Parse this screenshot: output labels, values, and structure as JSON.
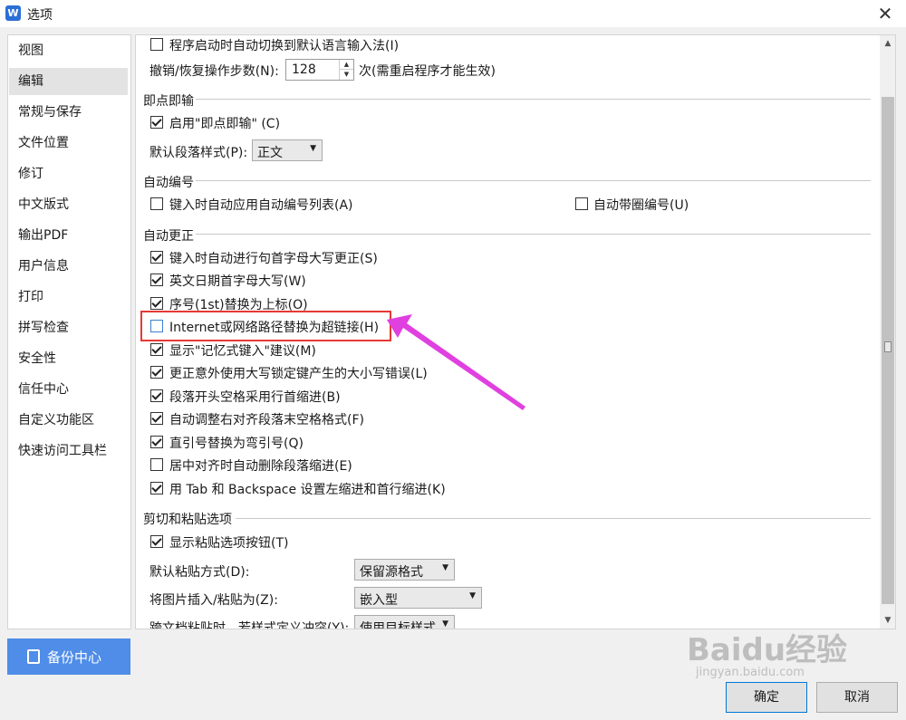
{
  "window": {
    "title": "选项",
    "close_glyph": "✕",
    "app_icon": "wps-writer-icon"
  },
  "sidebar": {
    "items": [
      {
        "label": "视图"
      },
      {
        "label": "编辑",
        "active": true
      },
      {
        "label": "常规与保存"
      },
      {
        "label": "文件位置"
      },
      {
        "label": "修订"
      },
      {
        "label": "中文版式"
      },
      {
        "label": "输出PDF"
      },
      {
        "label": "用户信息"
      },
      {
        "label": "打印"
      },
      {
        "label": "拼写检查"
      },
      {
        "label": "安全性"
      },
      {
        "label": "信任中心"
      },
      {
        "label": "自定义功能区"
      },
      {
        "label": "快速访问工具栏"
      }
    ]
  },
  "edit": {
    "auto_switch_ime": {
      "label": "程序启动时自动切换到默认语言输入法(I)",
      "checked": false
    },
    "undo_steps": {
      "label": "撤销/恢复操作步数(N):",
      "value": "128",
      "note": "次(需重启程序才能生效)"
    },
    "instant_input": {
      "title": "即点即输",
      "enable": {
        "label": "启用\"即点即输\" (C)",
        "checked": true
      },
      "default_style_label": "默认段落样式(P):",
      "default_style_value": "正文"
    },
    "auto_numbering": {
      "title": "自动编号",
      "apply_list": {
        "label": "键入时自动应用自动编号列表(A)",
        "checked": false
      },
      "circle_number": {
        "label": "自动带圈编号(U)",
        "checked": false
      }
    },
    "auto_correct": {
      "title": "自动更正",
      "items": [
        {
          "label": "键入时自动进行句首字母大写更正(S)",
          "checked": true
        },
        {
          "label": "英文日期首字母大写(W)",
          "checked": true
        },
        {
          "label": "序号(1st)替换为上标(O)",
          "checked": true
        },
        {
          "label": "Internet或网络路径替换为超链接(H)",
          "checked": false
        },
        {
          "label": "显示\"记忆式键入\"建议(M)",
          "checked": true
        },
        {
          "label": "更正意外使用大写锁定键产生的大小写错误(L)",
          "checked": true
        },
        {
          "label": "段落开头空格采用行首缩进(B)",
          "checked": true
        },
        {
          "label": "自动调整右对齐段落末空格格式(F)",
          "checked": true
        },
        {
          "label": "直引号替换为弯引号(Q)",
          "checked": true
        },
        {
          "label": "居中对齐时自动删除段落缩进(E)",
          "checked": false
        },
        {
          "label": "用 Tab 和 Backspace 设置左缩进和首行缩进(K)",
          "checked": true
        }
      ]
    },
    "cut_paste": {
      "title": "剪切和粘贴选项",
      "show_button": {
        "label": "显示粘贴选项按钮(T)",
        "checked": true
      },
      "default_paste_label": "默认粘贴方式(D):",
      "default_paste_value": "保留源格式",
      "picture_insert_label": "将图片插入/粘贴为(Z):",
      "picture_insert_value": "嵌入型",
      "cross_doc_label": "跨文档粘贴时，若样式定义冲突(Y):",
      "cross_doc_value": "使用目标样式"
    }
  },
  "footer": {
    "backup_label": "备份中心",
    "ok_label": "确定",
    "cancel_label": "取消"
  },
  "watermark": {
    "main": "Baidu经验",
    "sub": "jingyan.baidu.com"
  },
  "colors": {
    "highlight": "#e53935",
    "arrow": "#e040e0",
    "accent": "#4f8de8"
  }
}
